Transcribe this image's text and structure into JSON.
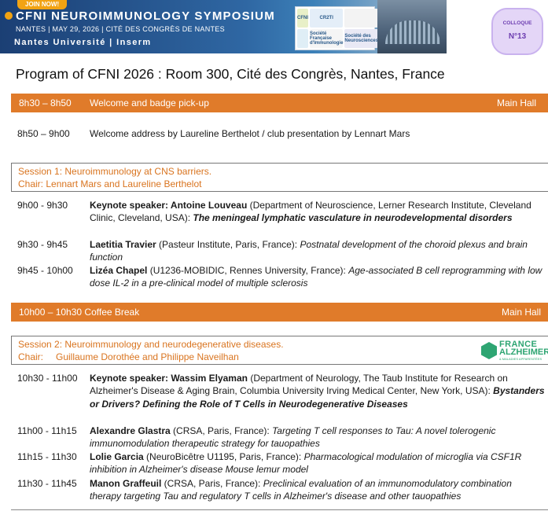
{
  "banner": {
    "join": "JOIN NOW!",
    "title": "CFNI NEUROIMMUNOLOGY SYMPOSIUM",
    "subtitle": "NANTES | MAY 29, 2026 | CITÉ DES CONGRÈS DE NANTES",
    "institutions": "Nantes Université | Inserm",
    "logos": [
      "CFNI",
      "CR2TI",
      "",
      "",
      "Société Française d'Immunologie",
      "Société des Neurosciences"
    ]
  },
  "colloque": {
    "label": "COLLOQUE",
    "number": "N°13"
  },
  "page_title": "Program of CFNI 2026 : Room 300, Cité des Congrès, Nantes, France",
  "welcome": {
    "time": "8h30 – 8h50",
    "label": "Welcome and badge pick-up",
    "location": "Main Hall"
  },
  "address": {
    "time": "8h50 – 9h00",
    "text": "Welcome address by Laureline Berthelot / club presentation by Lennart Mars"
  },
  "session1": {
    "title": "Session 1: Neuroimmunology at CNS barriers.",
    "chair": "Chair: Lennart Mars and Laureline Berthelot",
    "talks": [
      {
        "time": "9h00 - 9h30",
        "l1_speaker": "Keynote speaker: Antoine Louveau",
        "l1_rest": " (Department of Neuroscience, Lerner Research Institute, Cleveland",
        "l2_plain": "Clinic, Cleveland, USA): ",
        "l2_title": "The meningeal lymphatic vasculature in neurodevelopmental disorders"
      },
      {
        "time": "9h30 - 9h45",
        "l1_speaker": "Laetitia Travier",
        "l1_rest": " (Pasteur Institute, Paris, France): ",
        "l1_title": "Postnatal development of the choroid plexus and brain",
        "l2_title": "function"
      },
      {
        "time": "9h45 - 10h00",
        "l1_speaker": "Lizéa Chapel",
        "l1_rest": " (U1236-MOBIDIC, Rennes University, France): ",
        "l1_title": "Age-associated B cell reprogramming with low",
        "l2_title": "dose IL-2 in a pre-clinical model of multiple sclerosis"
      }
    ]
  },
  "coffee": {
    "label": "10h00 – 10h30 Coffee Break",
    "location": "Main Hall"
  },
  "session2": {
    "title": "Session 2: Neuroimmunology and neurodegenerative diseases.",
    "chair_prefix": "Chair:",
    "chair_names": "Guillaume Dorothée and Philippe Naveilhan",
    "sponsor": {
      "line1": "FRANCE",
      "line2": "ALZHEIMER",
      "line3": "& MALADIES APPARENTÉES"
    },
    "talks": [
      {
        "time": "10h30 - 11h00",
        "l1_speaker": "Keynote speaker: Wassim Elyaman",
        "l1_rest": " (Department of Neurology, The Taub Institute for Research on",
        "l2_plain": "Alzheimer's Disease & Aging Brain, Columbia University Irving Medical Center, New York, USA): ",
        "l2_title": "Bystanders",
        "l3_title": "or Drivers? Defining the Role of T Cells in Neurodegenerative Diseases"
      },
      {
        "time": "11h00 - 11h15",
        "l1_speaker": "Alexandre Glastra",
        "l1_rest": " (CRSA, Paris, France): ",
        "l1_title": "Targeting T cell responses to Tau: A novel tolerogenic",
        "l2_title": "immunomodulation therapeutic strategy for tauopathies"
      },
      {
        "time": "11h15 - 11h30",
        "l1_speaker": "Lolie Garcia",
        "l1_rest": " (NeuroBicêtre U1195, Paris, France): ",
        "l1_title": "Pharmacological modulation of microglia via CSF1R",
        "l2_title": "inhibition in Alzheimer's disease Mouse lemur model"
      },
      {
        "time": "11h30 - 11h45",
        "l1_speaker": "Manon Graffeuil",
        "l1_rest": " (CRSA, Paris, France): ",
        "l1_title": "Preclinical evaluation of an immunomodulatory combination",
        "l2_title": "therapy targeting Tau and regulatory T cells in Alzheimer's disease and other tauopathies"
      }
    ]
  }
}
